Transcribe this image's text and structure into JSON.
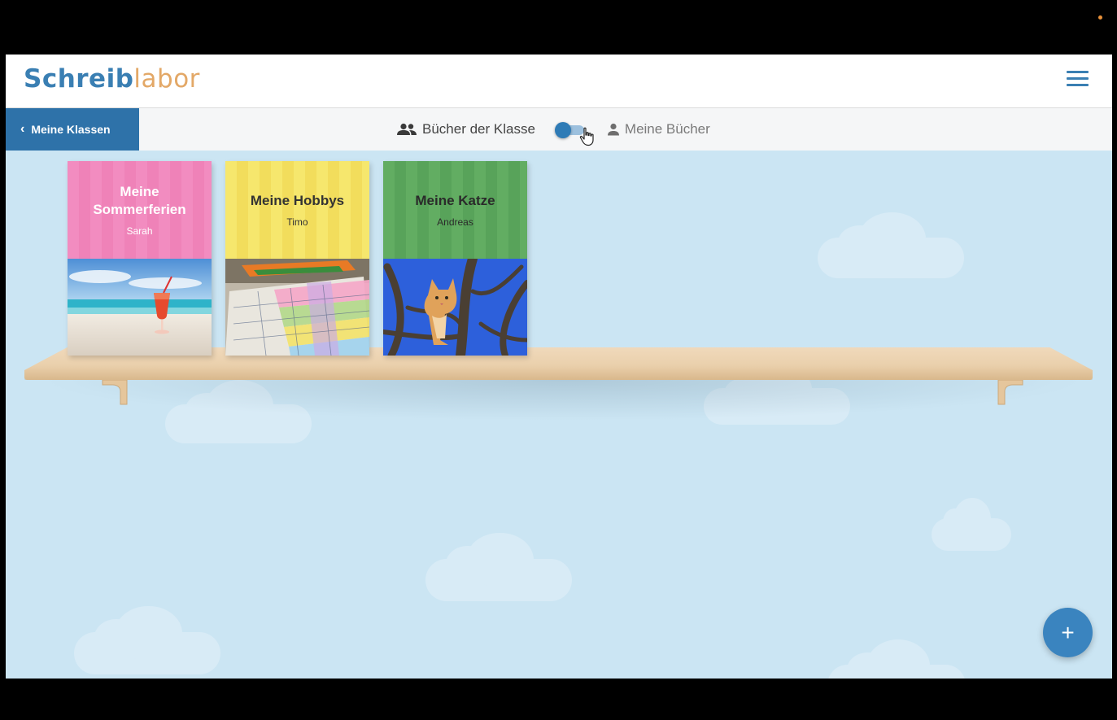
{
  "header": {
    "logo_part1": "Schreib",
    "logo_part2": "labor",
    "menu_icon": "hamburger-menu-icon"
  },
  "subbar": {
    "back_label": "Meine Klassen",
    "class_books_label": "Bücher der Klasse",
    "my_books_label": "Meine Bücher",
    "toggle_state": "class-books"
  },
  "books": [
    {
      "title": "Meine Sommerferien",
      "author": "Sarah",
      "image": "beach-cocktail"
    },
    {
      "title": "Meine Hobbys",
      "author": "Timo",
      "image": "colored-pencils-worksheet"
    },
    {
      "title": "Meine Katze",
      "author": "Andreas",
      "image": "cat-in-tree"
    }
  ],
  "fab": {
    "label": "+"
  },
  "colors": {
    "accent": "#2e72a9",
    "sky": "#cbe5f3",
    "book_pink": "#f28cc0",
    "book_yellow": "#f6e76d",
    "book_green": "#62ad62",
    "shelf": "#ead0ac"
  }
}
